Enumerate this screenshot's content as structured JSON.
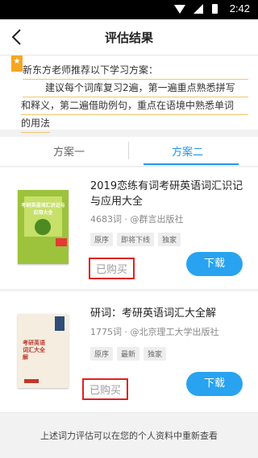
{
  "status_bar": {
    "time": "2:42"
  },
  "header": {
    "title": "评估结果"
  },
  "recommendation": {
    "intro": "新东方老师推荐以下学习方案：",
    "lines": [
      "建议每个词库复习2遍，第一遍重点熟悉拼写",
      "和释义，第二遍借助例句，重点在语境中熟悉单词",
      "的用法"
    ]
  },
  "tabs": [
    {
      "label": "方案一",
      "active": false
    },
    {
      "label": "方案二",
      "active": true
    }
  ],
  "books": [
    {
      "title": "2019恋练有词考研英语词汇识记与应用大全",
      "word_count": "4683词",
      "publisher": "@群言出版社",
      "tags": [
        "原序",
        "即将下线",
        "独家"
      ],
      "purchased_label": "已购买",
      "download_label": "下载",
      "cover_title": "考研英语词汇识记与应用大全"
    },
    {
      "title": "研词：考研英语词汇大全解",
      "word_count": "1775词",
      "publisher": "@北京理工大学出版社",
      "tags": [
        "原序",
        "最新",
        "独家"
      ],
      "purchased_label": "已购买",
      "download_label": "下载",
      "cover_title": "考研英语词汇大全解"
    }
  ],
  "footer": {
    "note": "上述词力评估可以在您的个人资料中重新查看"
  },
  "colors": {
    "accent": "#29a3f0",
    "tab_active": "#2196f3",
    "highlight_border": "#e02020",
    "star_badge": "#f5a623"
  }
}
